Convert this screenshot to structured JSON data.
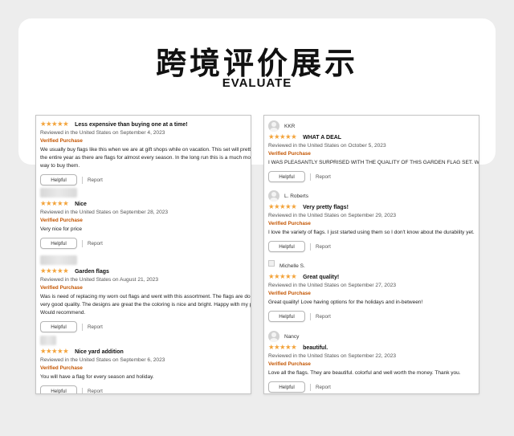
{
  "header": {
    "title": "跨境评价展示",
    "subtitle": "EVALUATE"
  },
  "common": {
    "stars": "★★★★★",
    "verified": "Verified Purchase",
    "helpful": "Helpful",
    "report": "Report"
  },
  "left_reviews": [
    {
      "title": "Less expensive than buying one at a time!",
      "meta": "Reviewed in the United States on September 4, 2023",
      "body": [
        "We usually buy flags like this when we are at gift shops while on vacation. This set will pretty much cover",
        "the entire year as there are flags for almost every season. In the long run this is a much more economical",
        "way to buy them."
      ]
    },
    {
      "title": "Nice",
      "meta": "Reviewed in the United States on September 28, 2023",
      "body": [
        "Very nice for price"
      ]
    },
    {
      "title": "Garden flags",
      "meta": "Reviewed in the United States on August 21, 2023",
      "body": [
        "Was is need of replacing my worn out flags and went with this assortment. The flags are double sided and",
        "very good quality. The designs are great the the coloring is nice and bright. Happy with my purchase.",
        "Would recommend."
      ]
    },
    {
      "title": "Nice yard addition",
      "meta": "Reviewed in the United States on September 6, 2023",
      "body": [
        "You will have a flag for every season and holiday."
      ]
    }
  ],
  "right_reviews": [
    {
      "user": "KKR",
      "title": "WHAT A DEAL",
      "meta": "Reviewed in the United States on October 5, 2023",
      "body": [
        "I WAS PLEASANTLY SURPRISED WITH THE QUALITY OF THIS GARDEN FLAG SET. WHAT A DEAL!"
      ]
    },
    {
      "user": "L. Roberts",
      "title": "Very pretty flags!",
      "meta": "Reviewed in the United States on September 29, 2023",
      "body": [
        "I love the variety of flags. I just started using them so I don't know about the durability yet."
      ]
    },
    {
      "user": "Michelle S.",
      "title": "Great quality!",
      "meta": "Reviewed in the United States on September 27, 2023",
      "body": [
        "Great quality! Love having options for the holidays and in-between!"
      ]
    },
    {
      "user": "Nancy",
      "title": "beautiful.",
      "meta": "Reviewed in the United States on September 22, 2023",
      "body": [
        "Love all the flags. They are beautiful. colorful and well worth the money. Thank you."
      ]
    }
  ],
  "colors": {
    "stars": "#f3a33a",
    "verified": "#c45500"
  }
}
